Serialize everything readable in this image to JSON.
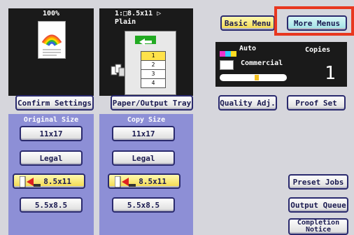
{
  "top_left": {
    "zoom": "100%",
    "paper_info": "1:□8.5x11 ▷",
    "paper_type": "Plain"
  },
  "tray_numbers": [
    "1",
    "2",
    "3",
    "4"
  ],
  "menu": {
    "basic_menu": "Basic Menu",
    "more_menus": "More Menus"
  },
  "settings": {
    "density_mode": "Auto",
    "original_mode": "Commercial",
    "copies_label": "Copies",
    "copies_value": "1"
  },
  "tabs": {
    "confirm_settings": "Confirm Settings",
    "paper_output_tray": "Paper/Output Tray",
    "quality_adj": "Quality Adj.",
    "proof_set": "Proof Set"
  },
  "original_size": {
    "header": "Original Size",
    "items": [
      "11x17",
      "Legal",
      "8.5x11",
      "5.5x8.5"
    ]
  },
  "copy_size": {
    "header": "Copy Size",
    "items": [
      "11x17",
      "Legal",
      "8.5x11",
      "5.5x8.5"
    ]
  },
  "right_buttons": {
    "preset_jobs": "Preset Jobs",
    "output_queue": "Output Queue",
    "completion_notice": "Completion Notice"
  },
  "colors": {
    "highlight": "#e8371f",
    "panel": "#8d8fd6",
    "dark": "#1a1a1a"
  }
}
